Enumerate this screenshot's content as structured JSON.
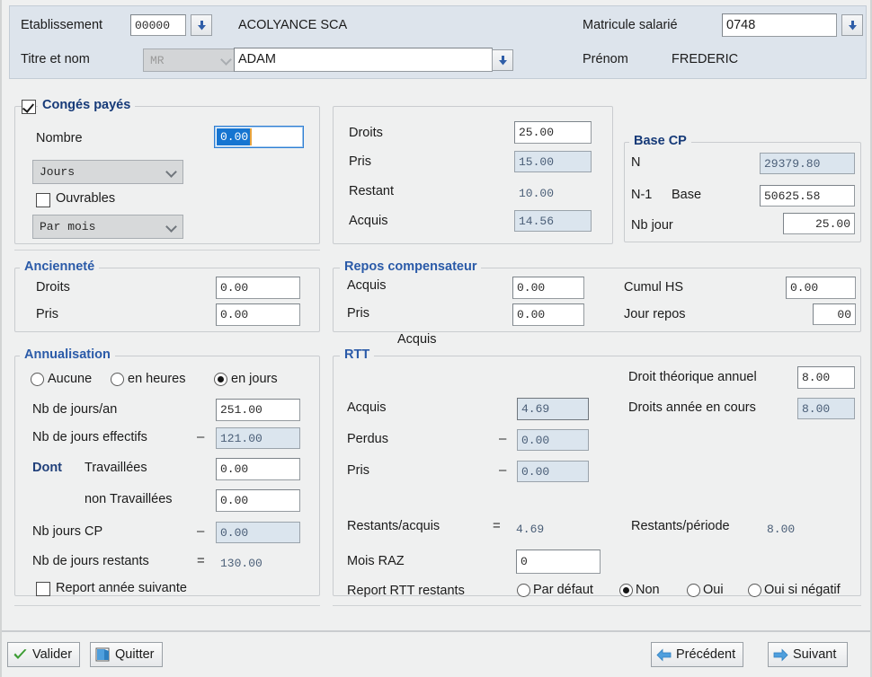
{
  "header": {
    "etablissement_label": "Etablissement",
    "etablissement_value": "00000",
    "company_name": "ACOLYANCE SCA",
    "titre_label": "Titre et nom",
    "titre_value": "MR",
    "nom_value": "ADAM",
    "matricule_label": "Matricule salarié",
    "matricule_value": "0748",
    "prenom_label": "Prénom",
    "prenom_value": "FREDERIC"
  },
  "conges": {
    "legend": "Congés payés",
    "checked": true,
    "nombre_label": "Nombre",
    "nombre_value": "0.00",
    "unit_select": "Jours",
    "ouvrables_label": "Ouvrables",
    "ouvrables_checked": false,
    "period_select": "Par mois",
    "droits_label": "Droits",
    "droits_value": "25.00",
    "pris_label": "Pris",
    "pris_value": "15.00",
    "restant_label": "Restant",
    "restant_value": "10.00",
    "acquis_label": "Acquis",
    "acquis_value": "14.56"
  },
  "base_cp": {
    "legend": "Base CP",
    "n_label": "N",
    "n_value": "29379.80",
    "n1_label": "N-1",
    "base_label": "Base",
    "n1_value": "50625.58",
    "nbjour_label": "Nb jour",
    "nbjour_value": "25.00"
  },
  "anciennete": {
    "legend": "Ancienneté",
    "droits_label": "Droits",
    "droits_value": "0.00",
    "pris_label": "Pris",
    "pris_value": "0.00"
  },
  "repos": {
    "legend": "Repos compensateur",
    "acquis_label": "Acquis",
    "acquis_value": "0.00",
    "pris_label": "Pris",
    "pris_value": "0.00",
    "cumul_label": "Cumul HS",
    "cumul_value": "0.00",
    "jour_repos_label": "Jour repos",
    "jour_repos_value": "00"
  },
  "annualisation": {
    "legend": "Annualisation",
    "radio_aucune": "Aucune",
    "radio_heures": "en heures",
    "radio_jours": "en jours",
    "selected_radio": "en jours",
    "jours_an_label": "Nb de jours/an",
    "jours_an_value": "251.00",
    "jours_effectifs_label": "Nb de jours effectifs",
    "jours_effectifs_op": "–",
    "jours_effectifs_value": "121.00",
    "dont_label": "Dont",
    "travaillees_label": "Travaillées",
    "travaillees_value": "0.00",
    "non_travaillees_label": "non Travaillées",
    "non_travaillees_value": "0.00",
    "jours_cp_label": "Nb jours CP",
    "jours_cp_op": "–",
    "jours_cp_value": "0.00",
    "jours_restants_label": "Nb de jours restants",
    "jours_restants_op": "=",
    "jours_restants_value": "130.00",
    "report_label": "Report année suivante",
    "report_checked": false
  },
  "rtt": {
    "legend": "RTT",
    "floating_label": "Acquis",
    "acquis_label": "Acquis",
    "acquis_value": "4.69",
    "perdus_label": "Perdus",
    "perdus_op": "–",
    "perdus_value": "0.00",
    "pris_label": "Pris",
    "pris_op": "–",
    "pris_value": "0.00",
    "droit_theorique_label": "Droit théorique annuel",
    "droit_theorique_value": "8.00",
    "droits_annee_label": "Droits année en cours",
    "droits_annee_value": "8.00",
    "restants_acquis_label": "Restants/acquis",
    "restants_acquis_op": "=",
    "restants_acquis_value": "4.69",
    "restants_periode_label": "Restants/période",
    "restants_periode_value": "8.00",
    "mois_raz_label": "Mois RAZ",
    "mois_raz_value": "0",
    "report_rtt_label": "Report RTT restants",
    "radio_defaut": "Par défaut",
    "radio_non": "Non",
    "radio_oui": "Oui",
    "radio_oui_neg": "Oui si négatif",
    "selected_radio": "Non"
  },
  "toolbar": {
    "valider_label": "Valider",
    "quitter_label": "Quitter",
    "precedent_label": "Précédent",
    "suivant_label": "Suivant"
  },
  "colors": {
    "header_bg": "#dde4ec",
    "body_bg": "#eff0f0",
    "legend_blue": "#2a5aa8",
    "readonly_bg": "#dbe5ee",
    "focus_blue": "#1675d1",
    "accent_green": "#3c9c33",
    "accent_arrow_blue": "#3f8fd0"
  }
}
